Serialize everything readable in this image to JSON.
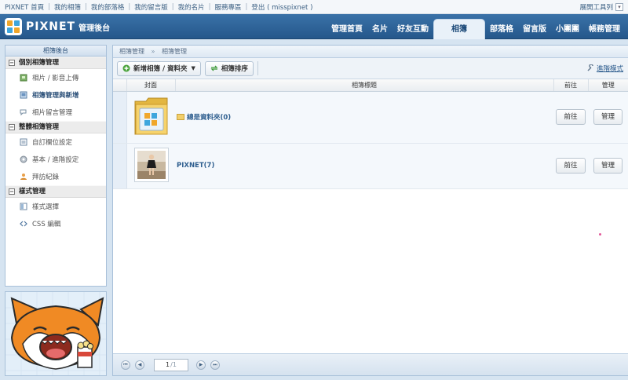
{
  "topbar": {
    "links": [
      "PIXNET 首頁",
      "我的相簿",
      "我的部落格",
      "我的留言版",
      "我的名片",
      "服務專區",
      "登出 ( misspixnet )"
    ],
    "tools_label": "展開工具列"
  },
  "header": {
    "logo_text": "PIXNET",
    "logo_sub": "管理後台",
    "nav": [
      {
        "label": "管理首頁",
        "active": false
      },
      {
        "label": "名片",
        "active": false
      },
      {
        "label": "好友互動",
        "active": false
      },
      {
        "label": "相簿",
        "active": true
      },
      {
        "label": "部落格",
        "active": false
      },
      {
        "label": "留言版",
        "active": false
      },
      {
        "label": "小團團",
        "active": false
      },
      {
        "label": "帳務管理",
        "active": false
      }
    ]
  },
  "sidebar": {
    "title": "相簿後台",
    "sections": [
      {
        "label": "個別相簿管理",
        "items": [
          {
            "label": "相片 / 影音上傳",
            "icon": "photo-upload-icon",
            "current": false
          },
          {
            "label": "相簿管理與新增",
            "icon": "album-manage-icon",
            "current": true
          },
          {
            "label": "相片留言管理",
            "icon": "comment-icon",
            "current": false
          }
        ]
      },
      {
        "label": "整體相簿管理",
        "items": [
          {
            "label": "自訂欄位設定",
            "icon": "custom-field-icon",
            "current": false
          },
          {
            "label": "基本 / 進階設定",
            "icon": "gear-icon",
            "current": false
          },
          {
            "label": "拜訪紀錄",
            "icon": "visit-log-icon",
            "current": false
          }
        ]
      },
      {
        "label": "樣式管理",
        "items": [
          {
            "label": "樣式選擇",
            "icon": "style-icon",
            "current": false
          },
          {
            "label": "CSS 編輯",
            "icon": "css-icon",
            "current": false
          }
        ]
      }
    ]
  },
  "main": {
    "breadcrumb": [
      "相簿管理",
      "相簿管理"
    ],
    "toolbar": {
      "add_label": "新增相簿 / 資料夾",
      "sort_label": "相簿排序",
      "advanced_label": "進階模式"
    },
    "table": {
      "headers": {
        "cover": "封面",
        "title": "相簿標題",
        "go": "前往",
        "manage": "管理"
      },
      "rows": [
        {
          "title": "總是資料夾(0)",
          "type": "folder",
          "go_label": "前往",
          "manage_label": "管理"
        },
        {
          "title": "PIXNET(7)",
          "type": "album",
          "go_label": "前往",
          "manage_label": "管理"
        }
      ]
    },
    "pager": {
      "current": "1",
      "total": "/1"
    }
  },
  "colors": {
    "header": "#2f6699",
    "accent": "#2f5f8f",
    "panel_border": "#a8c0d9"
  }
}
